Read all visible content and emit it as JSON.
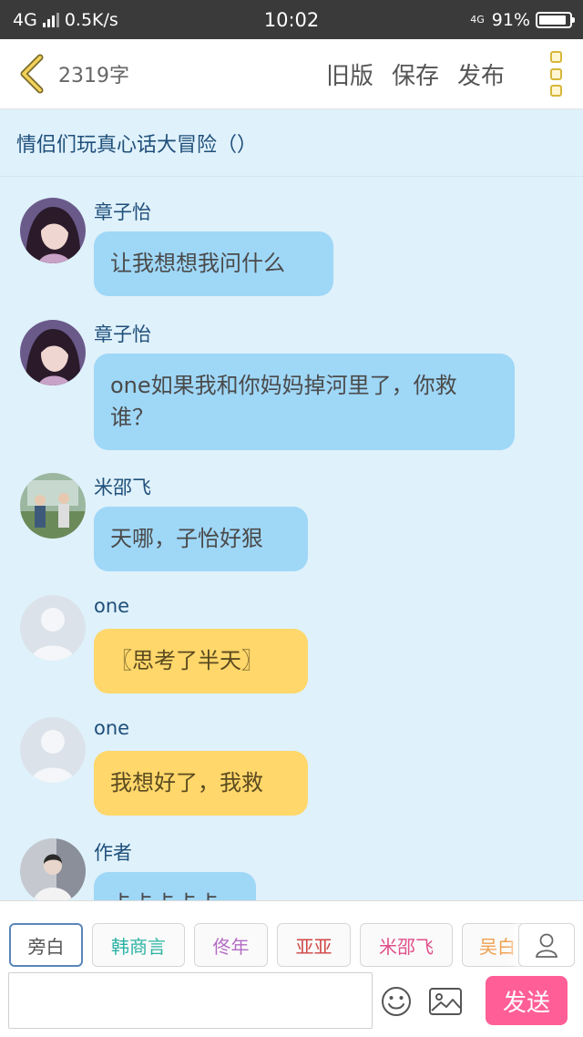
{
  "status_bar": {
    "carrier": "4G",
    "speed": "0.5K/s",
    "time": "10:02",
    "network": "4G",
    "battery_percent": "91%",
    "battery_level": 0.91
  },
  "header": {
    "word_count": "2319字",
    "old_version_label": "旧版",
    "save_label": "保存",
    "publish_label": "发布"
  },
  "story": {
    "title": "情侣们玩真心话大冒险（）"
  },
  "messages": [
    {
      "sender": "章子怡",
      "text": "让我想想我问什么",
      "style": "blue"
    },
    {
      "sender": "章子怡",
      "text": "one如果我和你妈妈掉河里了，你救谁？",
      "style": "blue"
    },
    {
      "sender": "米邵飞",
      "text": "天哪，子怡好狠",
      "style": "blue"
    },
    {
      "sender": "one",
      "text": "〖思考了半天〗",
      "style": "yellow"
    },
    {
      "sender": "one",
      "text": "我想好了，我救",
      "style": "yellow"
    },
    {
      "sender": "作者",
      "text": "卡卡卡卡卡",
      "style": "blue"
    }
  ],
  "characters": [
    {
      "label": "旁白",
      "color": "#555555"
    },
    {
      "label": "韩商言",
      "color": "#2bb3a3"
    },
    {
      "label": "佟年",
      "color": "#b36cc4"
    },
    {
      "label": "亚亚",
      "color": "#d04545"
    },
    {
      "label": "米邵飞",
      "color": "#e0508a"
    },
    {
      "label": "吴白",
      "color": "#f0a050"
    }
  ],
  "input": {
    "placeholder": "",
    "send_label": "发送"
  },
  "colors": {
    "chat_background": "#dff1fb",
    "bubble_blue": "#9fd7f7",
    "bubble_yellow": "#ffd76a",
    "send_button": "#ff5f96"
  }
}
